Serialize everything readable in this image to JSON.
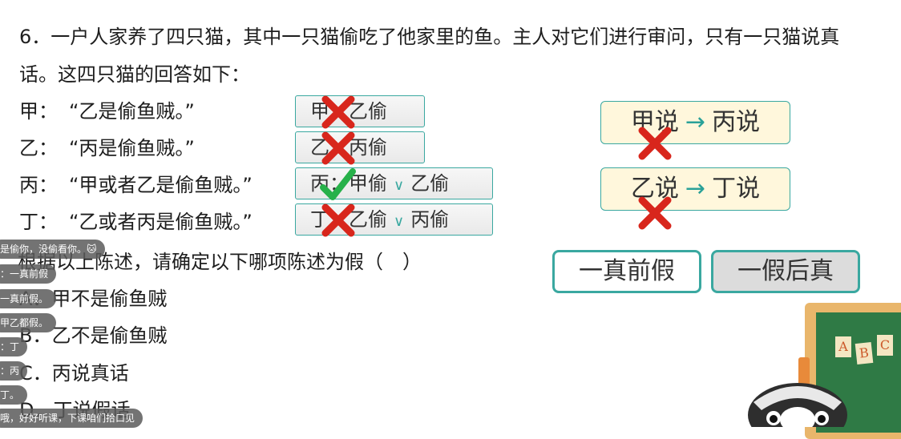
{
  "question": {
    "line1": "6．一户人家养了四只猫，其中一只猫偷吃了他家里的鱼。主人对它们进行审问，只有一只猫说真",
    "line2": "话。这四只猫的回答如下：",
    "statements": [
      {
        "speaker": "甲：",
        "text": "“乙是偷鱼贼。”"
      },
      {
        "speaker": "乙：",
        "text": "“丙是偷鱼贼。”"
      },
      {
        "speaker": "丙：",
        "text": "“甲或者乙是偷鱼贼。”"
      },
      {
        "speaker": "丁：",
        "text": "“乙或者丙是偷鱼贼。”"
      }
    ],
    "prompt": "根据以上陈述，请确定以下哪项陈述为假（　）",
    "options": [
      {
        "label": "A．",
        "text": "甲不是偷鱼贼"
      },
      {
        "label": "B．",
        "text": "乙不是偷鱼贼"
      },
      {
        "label": "C．",
        "text": "丙说真话"
      },
      {
        "label": "D．",
        "text": "丁说假话"
      }
    ]
  },
  "chips": [
    {
      "who": "甲：",
      "a": "乙偷",
      "or": "",
      "b": "",
      "mark": "x"
    },
    {
      "who": "乙：",
      "a": "丙偷",
      "or": "",
      "b": "",
      "mark": "x"
    },
    {
      "who": "丙：",
      "a": "甲偷",
      "or": "∨",
      "b": "乙偷",
      "mark": "check"
    },
    {
      "who": "丁：",
      "a": "乙偷",
      "or": "∨",
      "b": "丙偷",
      "mark": "x"
    }
  ],
  "logic": [
    {
      "left": "甲说",
      "arrow": "→",
      "right": "丙说"
    },
    {
      "left": "乙说",
      "arrow": "→",
      "right": "丁说"
    }
  ],
  "buttons": {
    "first": "一真前假",
    "second": "一假后真"
  },
  "chat": [
    "是偷你，没偷看你。🐱",
    "：一真前假",
    "一真前假。",
    "甲乙都假。",
    "：丁",
    "：丙",
    "丁。",
    "哦，好好听课，下课咱们拾口见"
  ],
  "board_letters": [
    "A",
    "B",
    "C"
  ],
  "colors": {
    "accent": "#3aa8a0",
    "cross": "#d8261c",
    "check": "#27b14a",
    "logic_bg": "#fff7dc"
  }
}
